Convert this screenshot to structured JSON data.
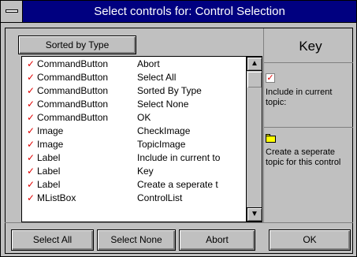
{
  "window": {
    "title": "Select controls for: Control Selection"
  },
  "list": {
    "sort_button": "Sorted by Type",
    "items": [
      {
        "checked": true,
        "type": "CommandButton",
        "name": "Abort"
      },
      {
        "checked": true,
        "type": "CommandButton",
        "name": "Select All"
      },
      {
        "checked": true,
        "type": "CommandButton",
        "name": "Sorted By Type"
      },
      {
        "checked": true,
        "type": "CommandButton",
        "name": "Select None"
      },
      {
        "checked": true,
        "type": "CommandButton",
        "name": "OK"
      },
      {
        "checked": true,
        "type": "Image",
        "name": "CheckImage"
      },
      {
        "checked": true,
        "type": "Image",
        "name": "TopicImage"
      },
      {
        "checked": true,
        "type": "Label",
        "name": "Include in current to"
      },
      {
        "checked": true,
        "type": "Label",
        "name": "Key"
      },
      {
        "checked": true,
        "type": "Label",
        "name": "Create a seperate t"
      },
      {
        "checked": true,
        "type": "MListBox",
        "name": "ControlList"
      }
    ],
    "scroll_up": "▲",
    "scroll_down": "▼"
  },
  "key": {
    "heading": "Key",
    "include_text": "Include in current topic:",
    "create_text": "Create a seperate topic for this control",
    "check_color": "#e00000",
    "folder_color": "#ffff00"
  },
  "buttons": {
    "select_all": "Select All",
    "select_none": "Select None",
    "abort": "Abort",
    "ok": "OK"
  }
}
